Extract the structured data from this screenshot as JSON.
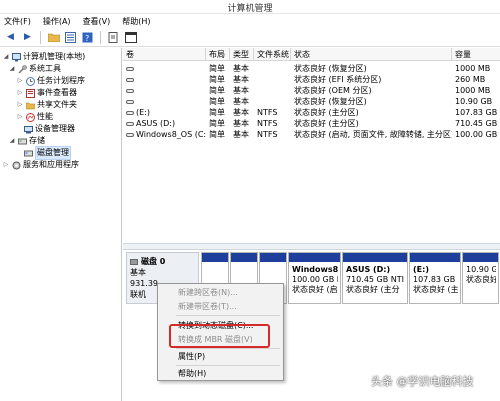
{
  "window": {
    "title": "计算机管理"
  },
  "menu": [
    "文件(F)",
    "操作(A)",
    "查看(V)",
    "帮助(H)"
  ],
  "toolbar": {
    "icons": [
      "back-arrow-icon",
      "forward-arrow-icon",
      "up-folder-icon",
      "properties-icon",
      "help-icon",
      "export-icon",
      "console-icon"
    ]
  },
  "tree": {
    "items": [
      {
        "label": "计算机管理(本地)",
        "icon": "computer-icon"
      },
      {
        "label": "系统工具",
        "icon": "tools-icon"
      },
      {
        "label": "任务计划程序",
        "icon": "clock-icon"
      },
      {
        "label": "事件查看器",
        "icon": "event-viewer-icon"
      },
      {
        "label": "共享文件夹",
        "icon": "shared-folder-icon"
      },
      {
        "label": "性能",
        "icon": "performance-icon"
      },
      {
        "label": "设备管理器",
        "icon": "device-manager-icon"
      },
      {
        "label": "存储",
        "icon": "storage-icon"
      },
      {
        "label": "磁盘管理",
        "icon": "disk-management-icon"
      },
      {
        "label": "服务和应用程序",
        "icon": "services-icon"
      }
    ]
  },
  "volumes": {
    "columns": [
      "卷",
      "布局",
      "类型",
      "文件系统",
      "状态",
      "容量"
    ],
    "rows": [
      [
        "",
        "简单",
        "基本",
        "",
        "状态良好 (恢复分区)",
        "1000 MB"
      ],
      [
        "",
        "简单",
        "基本",
        "",
        "状态良好 (EFI 系统分区)",
        "260 MB"
      ],
      [
        "",
        "简单",
        "基本",
        "",
        "状态良好 (OEM 分区)",
        "1000 MB"
      ],
      [
        "",
        "简单",
        "基本",
        "",
        "状态良好 (恢复分区)",
        "10.90 GB"
      ],
      [
        "(E:)",
        "简单",
        "基本",
        "NTFS",
        "状态良好 (主分区)",
        "107.83 GB"
      ],
      [
        "ASUS (D:)",
        "简单",
        "基本",
        "NTFS",
        "状态良好 (主分区)",
        "710.45 GB"
      ],
      [
        "Windows8_OS (C:)",
        "简单",
        "基本",
        "NTFS",
        "状态良好 (启动, 页面文件, 故障转储, 主分区)",
        "100.00 GB"
      ]
    ]
  },
  "disk": {
    "name": "磁盘 0",
    "type": "基本",
    "size": "931.39",
    "status": "联机",
    "partitions": [
      {
        "name": "",
        "size": "",
        "status": ""
      },
      {
        "name": "",
        "size": "",
        "status": ""
      },
      {
        "name": "",
        "size": "",
        "status": ""
      },
      {
        "name": "Windows8_",
        "size": "100.00 GB N",
        "status": "状态良好 (启"
      },
      {
        "name": "ASUS (D:)",
        "size": "710.45 GB NTI",
        "status": "状态良好 (主分"
      },
      {
        "name": "(E:)",
        "size": "107.83 GB NT",
        "status": "状态良好 (主分"
      },
      {
        "name": "",
        "size": "10.90 GB",
        "status": "状态良好"
      }
    ]
  },
  "context_menu": {
    "items": [
      {
        "label": "新建跨区卷(N)...",
        "enabled": false
      },
      {
        "label": "新建带区卷(T)...",
        "enabled": false
      },
      {
        "label": "转换到动态磁盘(C)...",
        "enabled": true
      },
      {
        "label": "转换成 MBR 磁盘(V)",
        "enabled": false
      },
      {
        "label": "属性(P)",
        "enabled": true
      },
      {
        "label": "帮助(H)",
        "enabled": true
      }
    ]
  },
  "watermark": "头条 @学识电脑科技",
  "colors": {
    "partition_band": "#1f3f9c",
    "highlight_box": "#d42a2a"
  }
}
